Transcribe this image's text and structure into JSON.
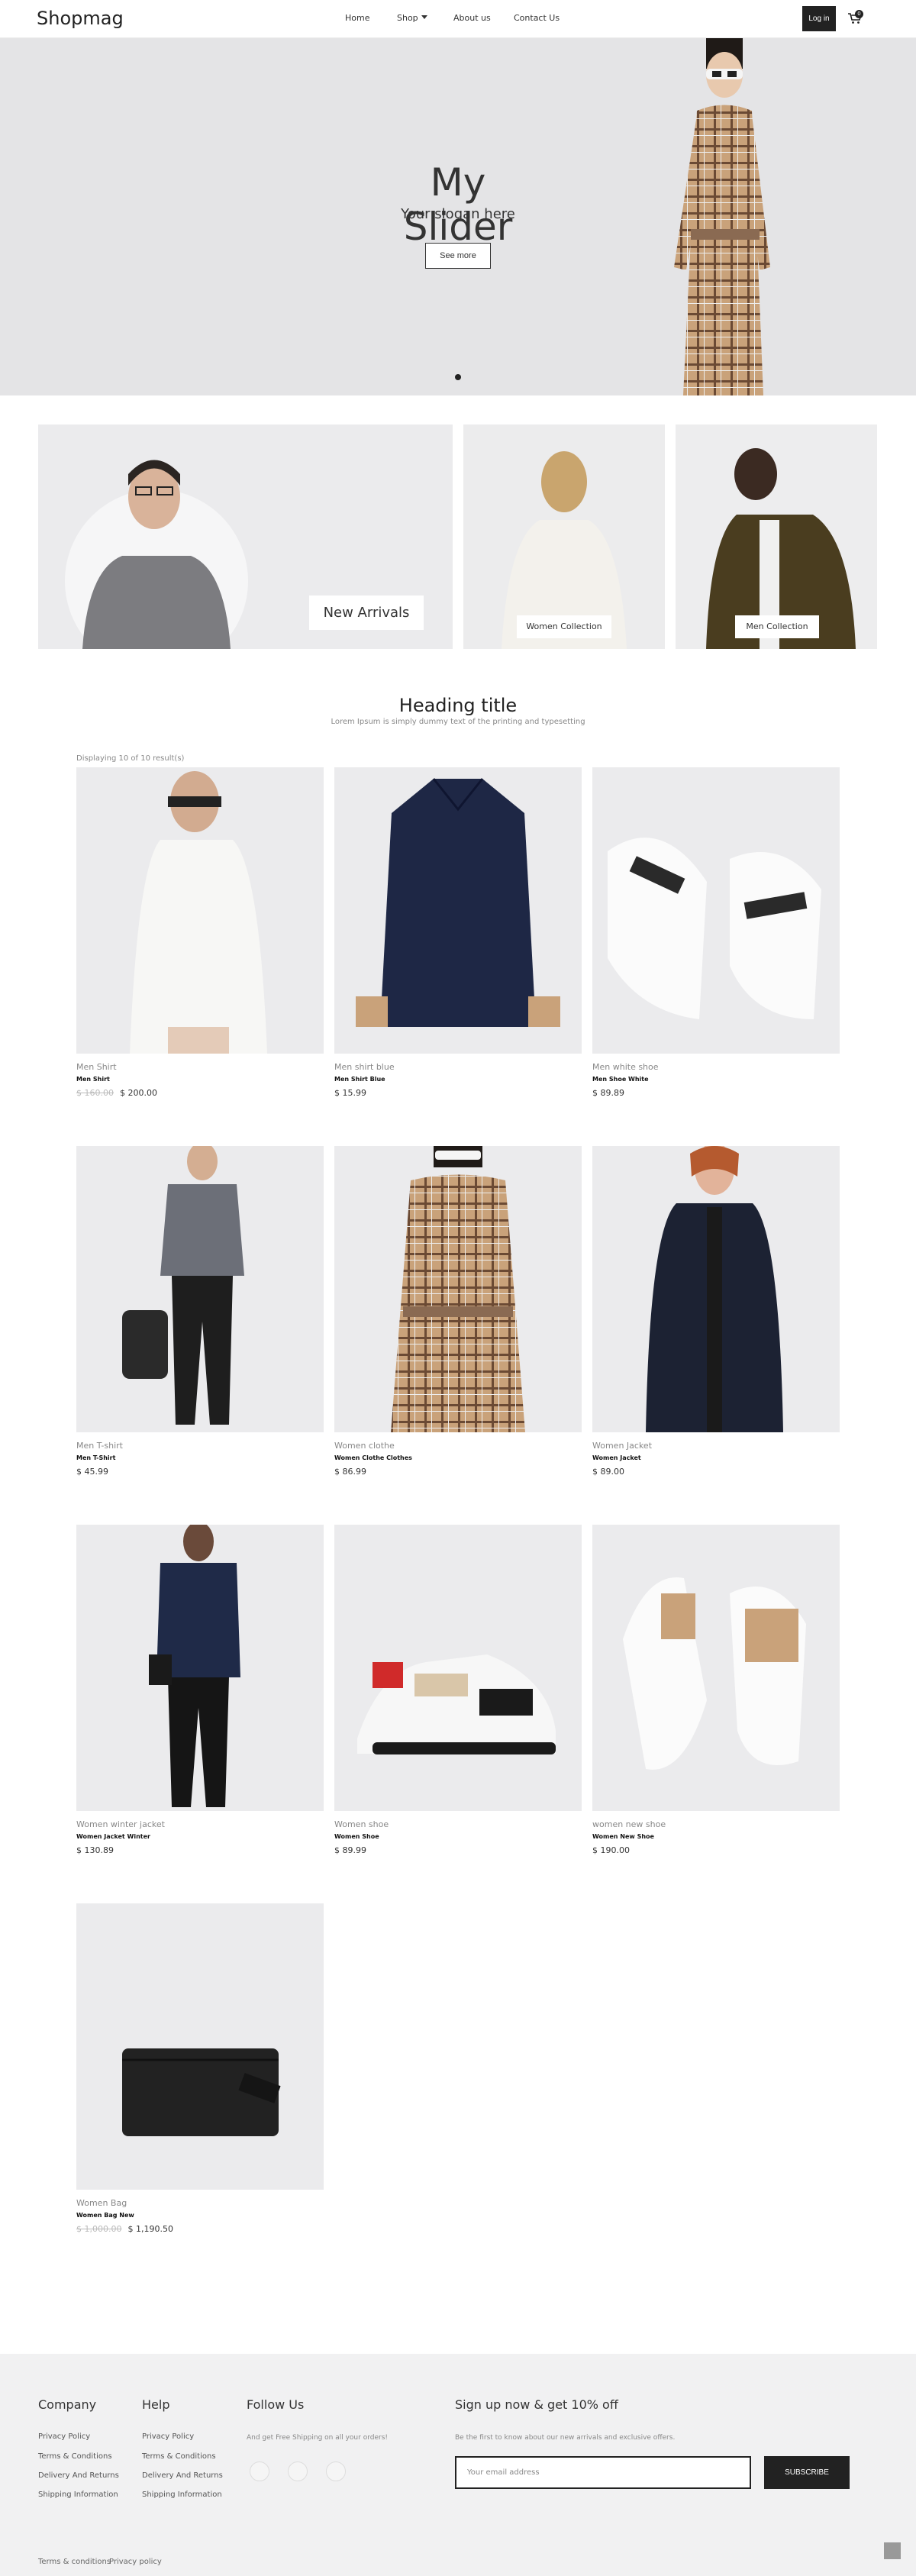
{
  "header": {
    "logo": "Shopmag",
    "nav": [
      {
        "label": "Home"
      },
      {
        "label": "Shop"
      },
      {
        "label": "About us"
      },
      {
        "label": "Contact Us"
      }
    ],
    "login_label": "Log in",
    "cart_icon": "cart-icon",
    "cart_count": "0"
  },
  "hero": {
    "title": "My Slider",
    "slogan": "Your slogan here",
    "button_label": "See more"
  },
  "collections": [
    {
      "label": "New Arrivals"
    },
    {
      "label": "Women Collection"
    },
    {
      "label": "Men Collection"
    }
  ],
  "section": {
    "title": "Heading title",
    "subtitle": "Lorem Ipsum is simply dummy text of the printing and typesetting",
    "count_text": "Displaying 10 of 10 result(s)"
  },
  "products": [
    {
      "name": "Men Shirt",
      "sub": "Men Shirt",
      "old_price": "$ 160.00",
      "price": "$ 200.00"
    },
    {
      "name": "Men shirt blue",
      "sub": "Men Shirt Blue",
      "old_price": "",
      "price": "$ 15.99"
    },
    {
      "name": "Men white shoe",
      "sub": "Men Shoe White",
      "old_price": "",
      "price": "$ 89.89"
    },
    {
      "name": "Men T-shirt",
      "sub": "Men T-Shirt",
      "old_price": "",
      "price": "$ 45.99"
    },
    {
      "name": "Women clothe",
      "sub": "Women Clothe Clothes",
      "old_price": "",
      "price": "$ 86.99"
    },
    {
      "name": "Women Jacket",
      "sub": "Women Jacket",
      "old_price": "",
      "price": "$ 89.00"
    },
    {
      "name": "Women winter jacket",
      "sub": "Women Jacket Winter",
      "old_price": "",
      "price": "$ 130.89"
    },
    {
      "name": "Women shoe",
      "sub": "Women Shoe",
      "old_price": "",
      "price": "$ 89.99"
    },
    {
      "name": "women new shoe",
      "sub": "Women New Shoe",
      "old_price": "",
      "price": "$ 190.00"
    },
    {
      "name": "Women Bag",
      "sub": "Women Bag New",
      "old_price": "$ 1,000.00",
      "price": "$ 1,190.50"
    }
  ],
  "footer": {
    "company": {
      "title": "Company",
      "links": [
        "Privacy Policy",
        "Terms & Conditions",
        "Delivery And Returns",
        "Shipping Information"
      ]
    },
    "help": {
      "title": "Help",
      "links": [
        "Privacy Policy",
        "Terms & Conditions",
        "Delivery And Returns",
        "Shipping Information"
      ]
    },
    "follow": {
      "title": "Follow Us",
      "text": "And get Free Shipping on all your orders!"
    },
    "signup": {
      "title": "Sign up now & get 10% off",
      "text": "Be the first to know about our new arrivals and exclusive offers.",
      "placeholder": "Your email address",
      "button_label": "SUBSCRIBE"
    },
    "bottom_links": [
      "Terms & conditions",
      "Privacy policy"
    ]
  },
  "colors": {
    "accent": "#222222",
    "hero_bg": "#e4e4e6",
    "footer_bg": "#f1f1f2"
  }
}
